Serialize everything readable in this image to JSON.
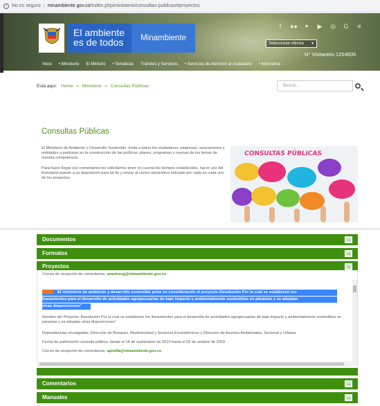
{
  "browser": {
    "security_label": "No es seguro",
    "url_host": "minambiente.gov.co",
    "url_path": "/index.php/ministerio/consultas-publicas#proyectos"
  },
  "header": {
    "brand_line1": "El ambiente",
    "brand_line2": "es de todos",
    "ministry_label": "Minambiente",
    "language_select": "Seleccionar idioma",
    "visitors": "N° Visitantes 1254505",
    "social_icons": [
      "facebook-icon",
      "flickr-icon",
      "twitter-icon",
      "youtube-icon",
      "instagram-icon",
      "googleplus-icon",
      "rss-icon"
    ],
    "nav": [
      "Inicio",
      "• Ministerio",
      "El Ministro",
      "• Temáticas",
      "Trámites y Servicios",
      "• Servicios de Atención al ciudadano",
      "• Normativa"
    ]
  },
  "breadcrumb": {
    "prefix": "Está aquí:",
    "items": [
      "Home",
      "Ministerio",
      "Consultas Públicas"
    ]
  },
  "search": {
    "placeholder": "Buscar..."
  },
  "section": {
    "title": "Consultas Públicas",
    "para1": "El Ministerio de Ambiente y Desarrollo Sostenible, invita a todos los ciudadanos, empresas, asociaciones y entidades a participar en la construcción de las políticas, planes, programas y normas de los temas de nuestra competencia.",
    "para2": "Para hacer llegar sus comentarios les solicitamos tener en cuenta los tiempos establecidos, hacer uso del formulario puesto a su disposición para tal fin y enviar al correo electrónico indicado por cada en cada uno de los proyectos.",
    "hero_label": "CONSULTAS PÚBLICAS"
  },
  "accordion": {
    "documentos": "Documentos",
    "formatos": "Formatos",
    "proyectos": "Proyectos",
    "comentarios": "Comentarios",
    "manuales": "Manuales"
  },
  "project": {
    "email_prefix_top": "Correo de recepción de comentarios:",
    "email_top": "aramirezg@minambiente.gov.co",
    "highlight_line1": "El ministerio de ambiente y desarrollo sostenible pone en consideración el proyecto Resolución Por la cual se establecen los",
    "highlight_line2": "lineamientos para el desarrollo de actividades agropecuarias de bajo impacto y ambientalmente sostenibles en páramos y se adoptan",
    "highlight_line3": "otras disposiciones\"",
    "name": "Nombre del Proyecto: Resolución Por la cual se establecen los lineamientos para el desarrollo de actividades agropecuarias de bajo impacto y ambientalmente sostenibles en páramos y se adoptan otras disposiciones\"",
    "dependencies": "Dependencias encargadas: Dirección de Bosques, Biodiversidad y Servicios Ecosistémicos y Dirección de Asuntos Ambientales, Sectorial y Urbana",
    "dates": "Fecha de publicación consulta pública: desde el 18 de septiembre de 2019 hasta el 02 de octubre de 2019",
    "email_prefix": "Correo de recepción de comentarios:",
    "email": "apinilla@minambiente.gov.co"
  }
}
